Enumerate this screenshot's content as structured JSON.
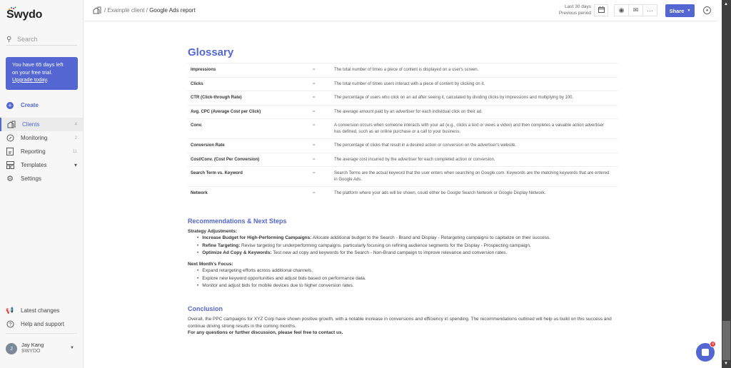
{
  "app": {
    "name": "Swydo"
  },
  "sidebar": {
    "search_placeholder": "Search",
    "trial": {
      "line1": "You have 65 days left",
      "line2": "on your free trial.",
      "link": "Upgrade today",
      "suffix": "."
    },
    "create_label": "Create",
    "items": [
      {
        "label": "Clients",
        "count": "4",
        "active": true
      },
      {
        "label": "Monitoring",
        "count": "2"
      },
      {
        "label": "Reporting",
        "count": "11"
      },
      {
        "label": "Templates",
        "count": "▾"
      },
      {
        "label": "Settings",
        "count": ""
      }
    ],
    "bottom": [
      {
        "label": "Latest changes"
      },
      {
        "label": "Help and support"
      }
    ],
    "user": {
      "initial": "J",
      "name": "Jay Kang",
      "org": "SWYDO"
    }
  },
  "topbar": {
    "breadcrumb": {
      "sep1": "/",
      "client": "Example client",
      "sep2": "/",
      "report": "Google Ads report"
    },
    "period": {
      "current": "Last 30 days",
      "compare": "Previous period"
    },
    "share_label": "Share"
  },
  "glossary": {
    "title": "Glossary",
    "rows": [
      {
        "term": "Impressions",
        "eq": "=",
        "def": "The total number of times a piece of content is displayed on a user's screen."
      },
      {
        "term": "Clicks",
        "eq": "=",
        "def": "The total number of times users interact with a piece of content by clicking on it."
      },
      {
        "term": "CTR (Click-through Rate)",
        "eq": "=",
        "def": "The percentage of users who click on an ad after seeing it, calculated by dividing clicks by impressions and multiplying by 100."
      },
      {
        "term": "Avg. CPC (Average Cost per Click)",
        "eq": "=",
        "def": "The average amount paid by an advertiser for each individual click on their ad."
      },
      {
        "term": "Conv.",
        "eq": "=",
        "def": "A conversion occurs when someone interacts with your ad (e.g., clicks a text or views a video) and then completes a valuable action advertiser has defined, such as an online purchase or a call to your business."
      },
      {
        "term": "Conversion Rate",
        "eq": "=",
        "def": "The percentage of clicks that result in a desired action or conversion on the advertiser's website."
      },
      {
        "term": "Cost/Conv. (Cost Per Conversion)",
        "eq": "=",
        "def": "The average cost incurred by the advertiser for each completed action or conversion."
      },
      {
        "term": "Search Term vs. Keyword",
        "eq": "=",
        "def": "Search Terms are the actual keyword that the user enters when searching on Google.com. Keywords are the matching keywords that are entered in Google Ads."
      },
      {
        "term": "Network",
        "eq": "=",
        "def": "The platform where your ads will be shown, could either be Google Search Network or Google Display Network."
      }
    ]
  },
  "recommendations": {
    "title": "Recommendations & Next Steps",
    "strategy_heading": "Strategy Adjustments:",
    "strategy": [
      {
        "bold": "Increase Budget for High-Performing Campaigns:",
        "text": " Allocate additional budget to the Search - Brand and Display - Retargeting campaigns to capitalize on their success."
      },
      {
        "bold": "Refine Targeting:",
        "text": " Revise targeting for underperforming campaigns, particularly focusing on refining audience segments for the Display - Prospecting campaign."
      },
      {
        "bold": "Optimize Ad Copy & Keywords:",
        "text": " Test new ad copy and keywords for the Search - Non-Brand campaign to improve relevance and conversion rates."
      }
    ],
    "focus_heading": "Next Month's Focus:",
    "focus": [
      "Expand retargeting efforts across additional channels.",
      "Explore new keyword opportunities and adjust bids based on performance data.",
      "Monitor and adjust bids for mobile devices due to higher conversion rates."
    ]
  },
  "conclusion": {
    "title": "Conclusion",
    "text": "Overall, the PPC campaigns for XYZ Corp have shown positive growth, with a notable increase in conversions and efficiency in spending. The recommendations outlined will help us build on this success and continue driving strong results in the coming months.",
    "closing": "For any questions or further discussion, please feel free to contact us."
  },
  "chat": {
    "badge": "4"
  }
}
